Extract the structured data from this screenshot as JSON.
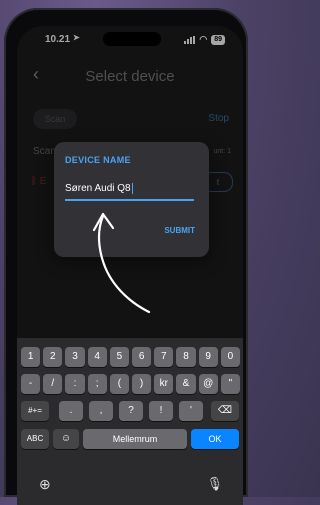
{
  "status": {
    "time": "10.21",
    "battery": "89"
  },
  "header": {
    "title": "Select device"
  },
  "controls": {
    "scan_label": "Scan",
    "stop_label": "Stop"
  },
  "list": {
    "scan_text": "Scan",
    "count_text": "unt: 1",
    "device_row_text": "E",
    "connect_label": "t"
  },
  "dialog": {
    "title": "DEVICE NAME",
    "input_value": "Søren Audi Q8",
    "submit_label": "SUBMIT"
  },
  "keyboard": {
    "row1": [
      "1",
      "2",
      "3",
      "4",
      "5",
      "6",
      "7",
      "8",
      "9",
      "0"
    ],
    "row2": [
      "-",
      "/",
      ":",
      ";",
      "(",
      ")",
      "kr",
      "&",
      "@",
      "\""
    ],
    "shift_label": "#+=",
    "row3": [
      ".",
      ",",
      "?",
      "!",
      "'"
    ],
    "abc_label": "ABC",
    "space_label": "Mellemrum",
    "ok_label": "OK"
  },
  "colors": {
    "accent": "#4aa3f0",
    "ok_button": "#0a84ff",
    "bluetooth": "#a83232"
  }
}
